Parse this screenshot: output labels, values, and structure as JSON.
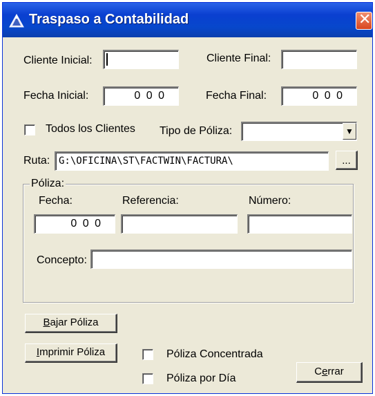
{
  "window": {
    "title": "Traspaso a Contabilidad",
    "close_symbol": "✕"
  },
  "filters": {
    "cliente_inicial_label": "Cliente Inicial:",
    "cliente_inicial_value": "",
    "cliente_final_label": "Cliente Final:",
    "cliente_final_value": "",
    "fecha_inicial_label": "Fecha Inicial:",
    "fecha_inicial_value": "0 0 0",
    "fecha_final_label": "Fecha Final:",
    "fecha_final_value": "0 0 0",
    "todos_clientes_label": "Todos los Clientes",
    "todos_clientes_checked": false,
    "tipo_poliza_label": "Tipo de Póliza:",
    "tipo_poliza_value": "",
    "ruta_label": "Ruta:",
    "ruta_value": "G:\\OFICINA\\ST\\FACTWIN\\FACTURA\\",
    "browse_label": "..."
  },
  "poliza": {
    "group_label": "Póliza:",
    "fecha_label": "Fecha:",
    "fecha_value": "0 0 0",
    "referencia_label": "Referencia:",
    "referencia_value": "",
    "numero_label": "Número:",
    "numero_value": "",
    "concepto_label": "Concepto:",
    "concepto_value": ""
  },
  "actions": {
    "bajar_poliza_label": "Bajar Póliza",
    "imprimir_poliza_label": "Imprimir Póliza",
    "poliza_concentrada_label": "Póliza Concentrada",
    "poliza_concentrada_checked": false,
    "poliza_por_dia_label": "Póliza por Día",
    "poliza_por_dia_checked": false,
    "cerrar_label": "Cerrar"
  },
  "colors": {
    "titlebar": "#0a3fd0",
    "window_bg": "#ece9d8",
    "close_button": "#d9461f"
  }
}
